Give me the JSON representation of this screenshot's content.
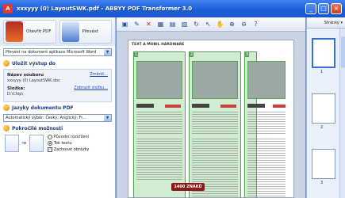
{
  "window": {
    "title": "xxxyyy (0) LayoutSWK.pdf - ABBYY PDF Transformer 3.0",
    "controls": [
      "_",
      "□",
      "×"
    ]
  },
  "left": {
    "open_button": "Otevřít PDF",
    "convert_button": "Převést",
    "convert_target": "Převést na dokument aplikace Microsoft Word",
    "save_section_title": "Uložit výstup do",
    "filename_label": "Název souboru",
    "filename_change": "Změnit...",
    "filename_value": "xxxyyy (0) LayoutSWK.doc",
    "folder_label": "Složka:",
    "folder_show": "Zobrazit složku...",
    "folder_value": "D:\\Chip\\",
    "language_section_title": "Jazyky dokumentu PDF",
    "language_value": "Automatický výběr: Český; Anglický; Fr...",
    "advanced_section_title": "Pokročilé možnosti",
    "opt_original": "Původní rozvržení",
    "opt_text_flow": "Tok textu",
    "opt_keep_images": "Zachovat obrázky"
  },
  "page": {
    "header_text": "TEXT A MOBIL HARDWARE",
    "region_numbers": [
      "1",
      "2",
      "3"
    ],
    "badge": "1400 ZNAKŮ"
  },
  "right": {
    "pages_label": "Stránky ▾",
    "thumb_numbers": [
      "1",
      "2",
      "3"
    ]
  }
}
